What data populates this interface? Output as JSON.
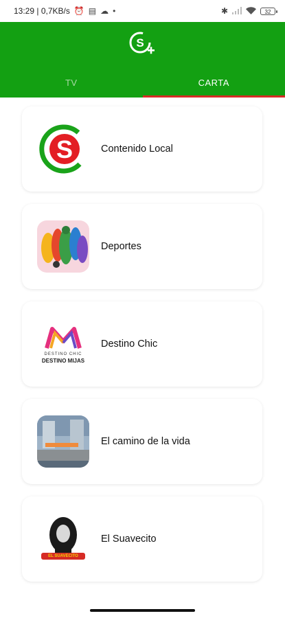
{
  "status_bar": {
    "time_speed": "13:29 | 0,7KB/s",
    "battery": "32"
  },
  "header": {
    "logo": "S+ logo",
    "tabs": [
      {
        "label": "TV",
        "active": false
      },
      {
        "label": "CARTA",
        "active": true
      }
    ]
  },
  "items": [
    {
      "label": "Contenido Local",
      "thumb": "red-s-logo"
    },
    {
      "label": "Deportes",
      "thumb": "sports-collage"
    },
    {
      "label": "Destino Chic",
      "thumb": "destino-chic-logo",
      "thumb_text": [
        "DESTINO CHIC",
        "DESTINO MIJAS"
      ]
    },
    {
      "label": "El camino de la vida",
      "thumb": "street-photo"
    },
    {
      "label": "El Suavecito",
      "thumb": "suavecito-logo",
      "thumb_text": "EL SUAVECITO"
    }
  ],
  "colors": {
    "header_green": "#13a012",
    "tab_indicator": "#d62b25",
    "inactive_tab": "#a9d9a6"
  }
}
